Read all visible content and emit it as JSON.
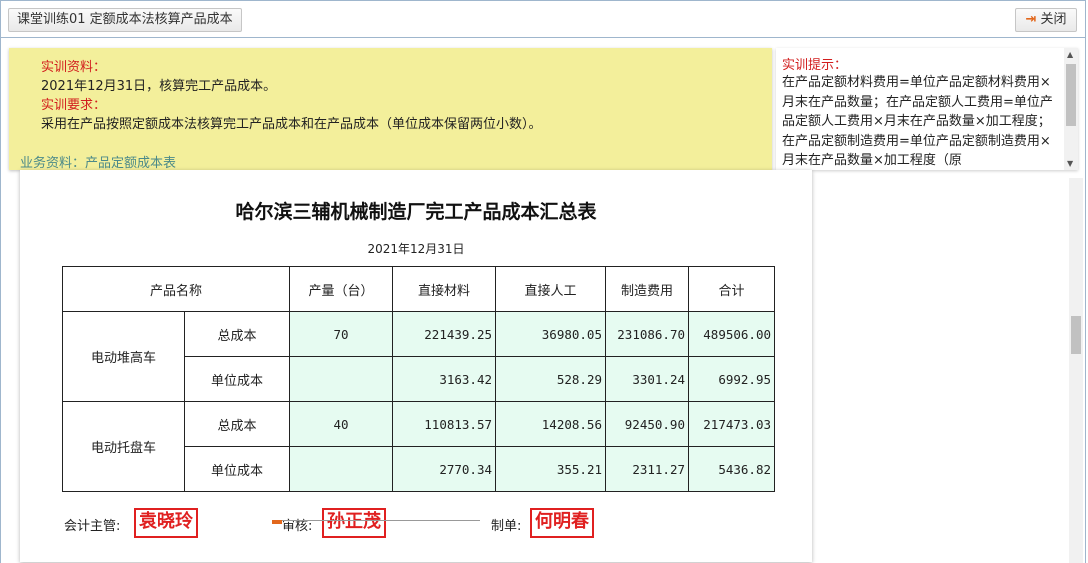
{
  "window": {
    "title_tab": "课堂训练01 定额成本法核算产品成本",
    "close_label": "关闭"
  },
  "info": {
    "material_label": "实训资料：",
    "material_text": "2021年12月31日，核算完工产品成本。",
    "requirement_label": "实训要求：",
    "requirement_text": "采用在产品按照定额成本法核算完工产品成本和在产品成本（单位成本保留两位小数）。",
    "business_link": "业务资料：产品定额成本表"
  },
  "hint": {
    "title": "实训提示：",
    "text": "在产品定额材料费用=单位产品定额材料费用×月末在产品数量；在产品定额人工费用=单位产品定额人工费用×月末在产品数量×加工程度；在产品定额制造费用=单位产品定额制造费用×月末在产品数量×加工程度（原"
  },
  "document": {
    "title": "哈尔滨三辅机械制造厂完工产品成本汇总表",
    "date": "2021年12月31日",
    "headers": {
      "product": "产品名称",
      "qty": "产量（台）",
      "material": "直接材料",
      "labor": "直接人工",
      "overhead": "制造费用",
      "total": "合计"
    },
    "rows": [
      {
        "name": "电动堆高车",
        "total_label": "总成本",
        "unit_label": "单位成本",
        "qty": "70",
        "total": [
          "221439.25",
          "36980.05",
          "231086.70",
          "489506.00"
        ],
        "unit": [
          "3163.42",
          "528.29",
          "3301.24",
          "6992.95"
        ]
      },
      {
        "name": "电动托盘车",
        "total_label": "总成本",
        "unit_label": "单位成本",
        "qty": "40",
        "total": [
          "110813.57",
          "14208.56",
          "92450.90",
          "217473.03"
        ],
        "unit": [
          "2770.34",
          "355.21",
          "2311.27",
          "5436.82"
        ]
      }
    ],
    "signatures": {
      "supervisor_label": "会计主管:",
      "supervisor_name": "袁晓玲",
      "reviewer_label": "审核:",
      "reviewer_name": "孙正茂",
      "preparer_label": "制单:",
      "preparer_name": "何明春"
    }
  },
  "colors": {
    "info_bg": "#f3ef9b",
    "label_red": "#d21e1e",
    "cell_fill": "#e6fbf1",
    "stamp_red": "#e02020"
  }
}
